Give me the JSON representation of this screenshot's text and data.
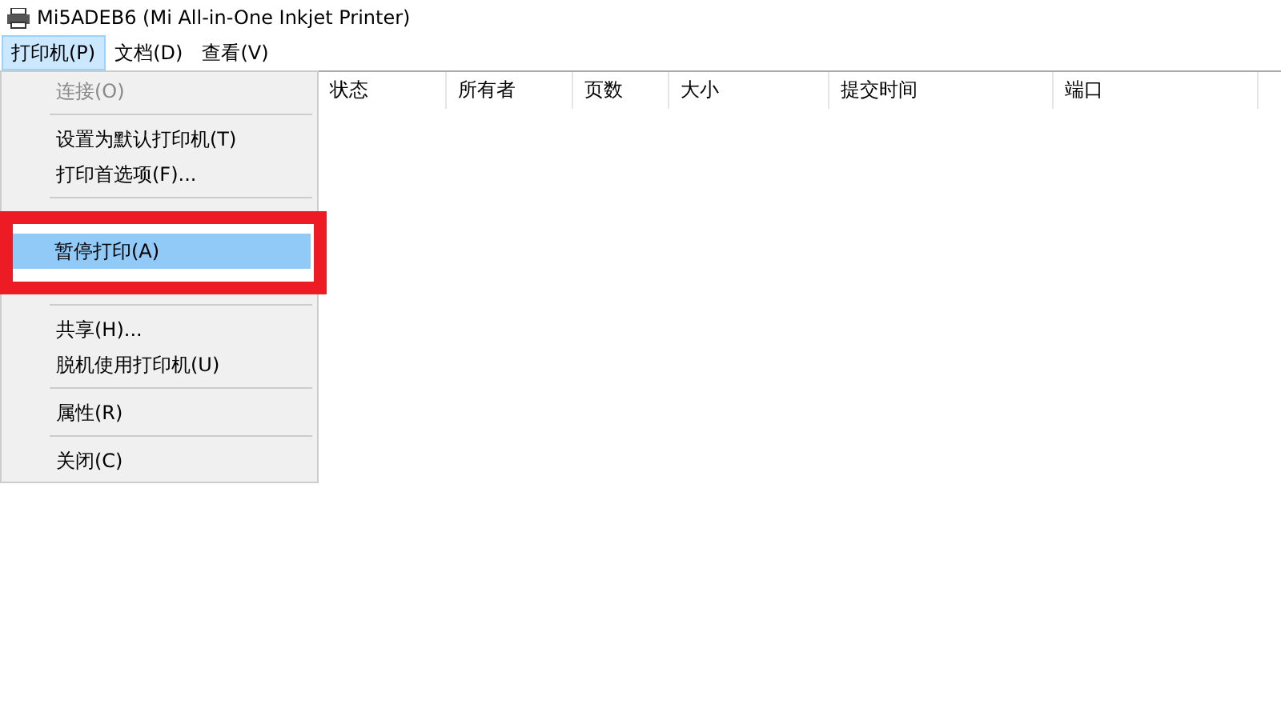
{
  "window": {
    "title": "Mi5ADEB6 (Mi All-in-One Inkjet Printer)"
  },
  "menubar": [
    {
      "label": "打印机(P)",
      "selected": true
    },
    {
      "label": "文档(D)",
      "selected": false
    },
    {
      "label": "查看(V)",
      "selected": false
    }
  ],
  "menu": {
    "items": [
      {
        "kind": "item",
        "label": "连接(O)",
        "disabled": true,
        "selected": false
      },
      {
        "kind": "separator"
      },
      {
        "kind": "item",
        "label": "设置为默认打印机(T)",
        "disabled": false,
        "selected": false
      },
      {
        "kind": "item",
        "label": "打印首选项(F)...",
        "disabled": false,
        "selected": false
      },
      {
        "kind": "separator"
      },
      {
        "kind": "item",
        "label": "暂停打印(A)",
        "disabled": false,
        "selected": true
      },
      {
        "kind": "separator"
      },
      {
        "kind": "item",
        "label": "共享(H)...",
        "disabled": false,
        "selected": false
      },
      {
        "kind": "item",
        "label": "脱机使用打印机(U)",
        "disabled": false,
        "selected": false
      },
      {
        "kind": "separator"
      },
      {
        "kind": "item",
        "label": "属性(R)",
        "disabled": false,
        "selected": false
      },
      {
        "kind": "separator"
      },
      {
        "kind": "item",
        "label": "关闭(C)",
        "disabled": false,
        "selected": false
      }
    ]
  },
  "annotation": {
    "kind": "red-frame"
  },
  "table": {
    "columns": [
      "状态",
      "所有者",
      "页数",
      "大小",
      "提交时间",
      "端口"
    ]
  }
}
